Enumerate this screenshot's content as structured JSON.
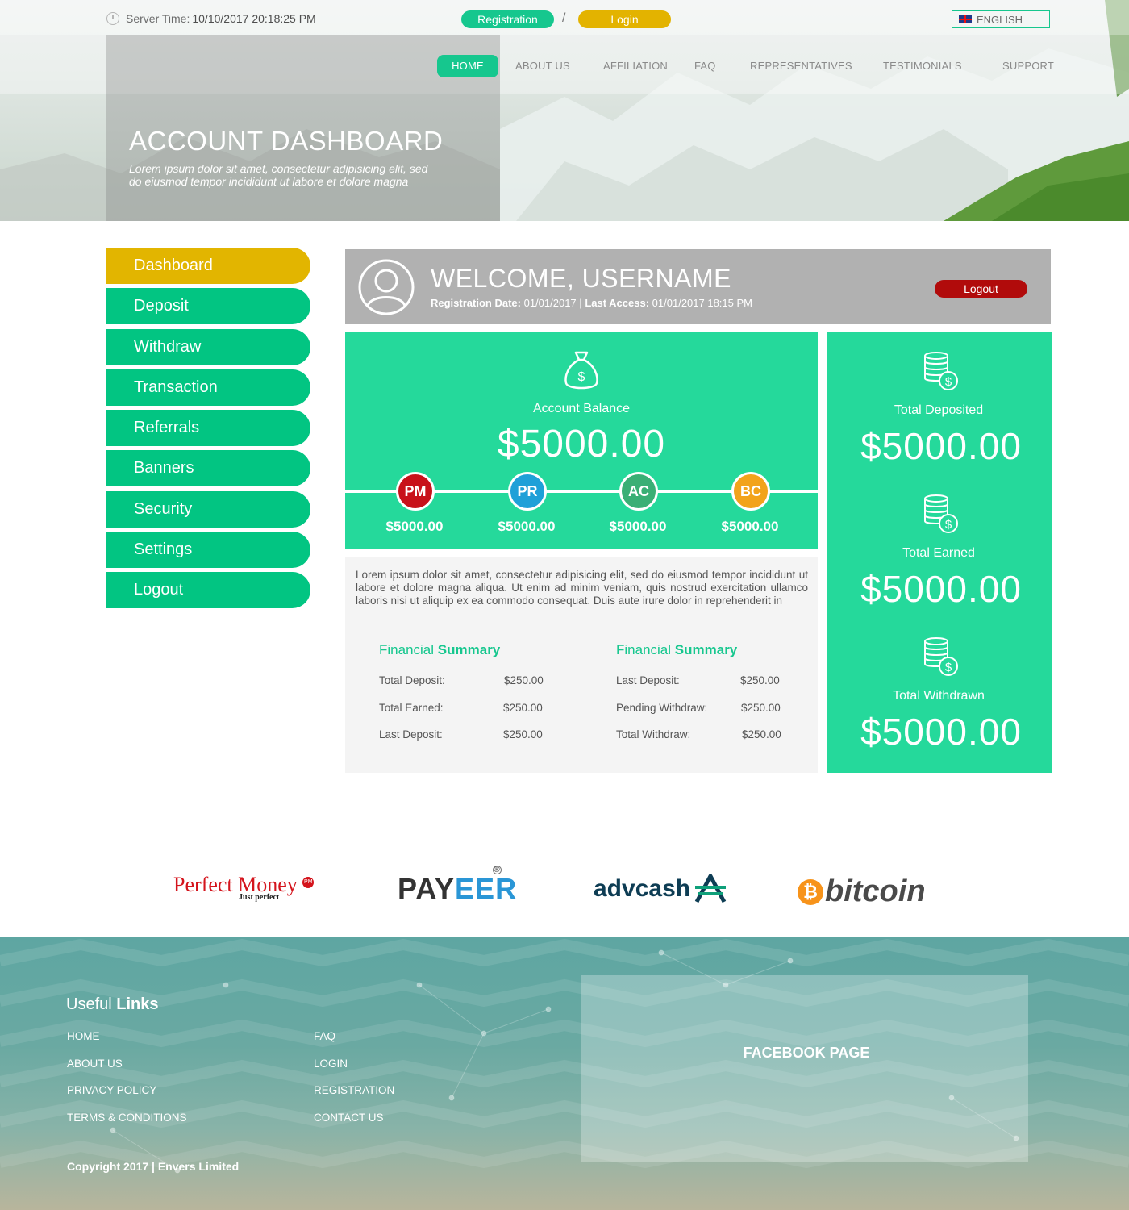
{
  "topbar": {
    "server_time_label": "Server Time:",
    "server_time_value": "10/10/2017 20:18:25 PM",
    "registration_label": "Registration",
    "separator": "/",
    "login_label": "Login",
    "language_label": "ENGLISH"
  },
  "nav": {
    "items": [
      {
        "label": "HOME",
        "active": true
      },
      {
        "label": "ABOUT US"
      },
      {
        "label": "AFFILIATION"
      },
      {
        "label": "FAQ"
      },
      {
        "label": "REPRESENTATIVES"
      },
      {
        "label": "TESTIMONIALS"
      },
      {
        "label": "SUPPORT"
      }
    ]
  },
  "hero": {
    "title": "ACCOUNT DASHBOARD",
    "subtitle": "Lorem ipsum dolor sit amet, consectetur adipisicing elit, sed do eiusmod tempor incididunt ut labore et dolore magna"
  },
  "sidebar": {
    "items": [
      {
        "label": "Dashboard",
        "active": true
      },
      {
        "label": "Deposit"
      },
      {
        "label": "Withdraw"
      },
      {
        "label": "Transaction"
      },
      {
        "label": "Referrals"
      },
      {
        "label": "Banners"
      },
      {
        "label": "Security"
      },
      {
        "label": "Settings"
      },
      {
        "label": "Logout"
      }
    ]
  },
  "welcome": {
    "greeting": "WELCOME,",
    "username": "USERNAME",
    "registration_label": "Registration Date:",
    "registration_value": "01/01/2017",
    "separator": "|",
    "last_access_label": "Last Access:",
    "last_access_value": "01/01/2017 18:15 PM",
    "logout_label": "Logout"
  },
  "balance": {
    "label": "Account Balance",
    "value": "$5000.00",
    "processors": [
      {
        "code": "PM",
        "value": "$5000.00",
        "color": "#c8111a"
      },
      {
        "code": "PR",
        "value": "$5000.00",
        "color": "#1fa0d8"
      },
      {
        "code": "AC",
        "value": "$5000.00",
        "color": "#3aaf75"
      },
      {
        "code": "BC",
        "value": "$5000.00",
        "color": "#f2a31b"
      }
    ]
  },
  "info": {
    "lorem": "Lorem ipsum dolor sit amet, consectetur adipisicing elit, sed do eiusmod tempor incididunt ut labore et dolore magna aliqua. Ut enim ad minim veniam, quis nostrud exercitation ullamco laboris nisi ut aliquip ex ea commodo consequat. Duis aute irure dolor in reprehenderit in",
    "summary_title_light": "Financial",
    "summary_title_bold": "Summary",
    "left": [
      {
        "label": "Total Deposit:",
        "value": "$250.00"
      },
      {
        "label": "Total Earned:",
        "value": "$250.00"
      },
      {
        "label": "Last Deposit:",
        "value": "$250.00"
      }
    ],
    "right": [
      {
        "label": "Last Deposit:",
        "value": "$250.00"
      },
      {
        "label": "Pending Withdraw:",
        "value": "$250.00"
      },
      {
        "label": "Total Withdraw:",
        "value": "$250.00"
      }
    ]
  },
  "stats": [
    {
      "label": "Total Deposited",
      "value": "$5000.00"
    },
    {
      "label": "Total Earned",
      "value": "$5000.00"
    },
    {
      "label": "Total Withdrawn",
      "value": "$5000.00"
    }
  ],
  "payment_logos": {
    "perfect_money": "Perfect Money",
    "perfect_money_tagline": "Just perfect",
    "perfect_money_badge": "PM",
    "payeer_dark": "PAY",
    "payeer_blue": "EER",
    "payeer_mark": "®",
    "advcash": "advcash",
    "bitcoin": "bitcoin",
    "bitcoin_symbol": "₿"
  },
  "footer": {
    "useful_light": "Useful",
    "useful_bold": "Links",
    "links_left": [
      "HOME",
      "ABOUT US",
      "PRIVACY POLICY",
      "TERMS & CONDITIONS"
    ],
    "links_right": [
      "FAQ",
      "LOGIN",
      "REGISTRATION",
      "CONTACT US"
    ],
    "facebook_title": "FACEBOOK PAGE",
    "copyright": "Copyright 2017 | Envers Limited"
  },
  "colors": {
    "accent_green": "#16c78e",
    "panel_green": "#25d99b",
    "accent_gold": "#e2b500",
    "logout_red": "#b10b0b"
  }
}
